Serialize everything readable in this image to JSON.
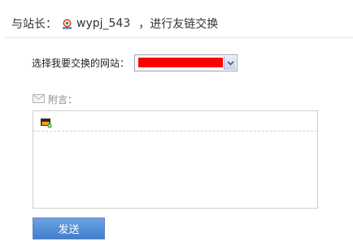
{
  "header": {
    "prefix": "与站长：",
    "logo_icon": "site-logo-icon",
    "username": "wypj_543",
    "suffix": "，进行友链交换"
  },
  "form": {
    "select_label": "选择我要交换的网站：",
    "select_value_color": "#ff0000",
    "message_label": "附言：",
    "message_icon": "mail-icon",
    "toolbar_icon": "insert-image-icon",
    "send_label": "发送"
  },
  "colors": {
    "send_button": "#4a88d6",
    "selected_value_bar": "#ff0000"
  }
}
